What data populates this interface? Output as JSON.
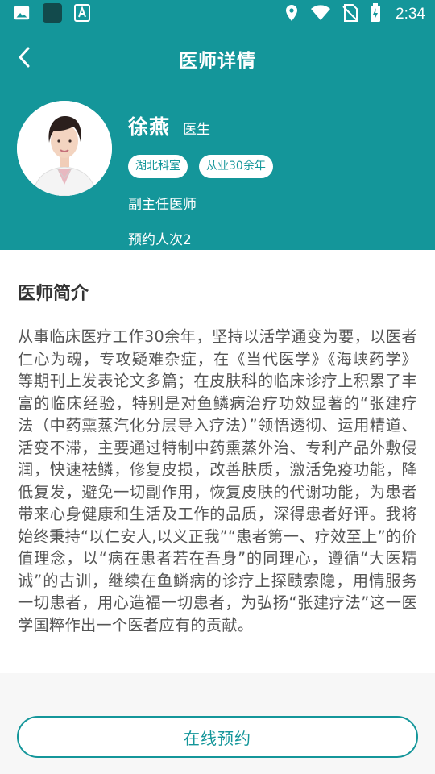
{
  "status_bar": {
    "time": "2:34",
    "left_icons": [
      "image-icon",
      "app-square-icon",
      "font-icon"
    ],
    "right_icons": [
      "location-icon",
      "wifi-icon",
      "no-sim-icon",
      "battery-icon"
    ]
  },
  "header": {
    "title": "医师详情",
    "back_icon": "chevron-left-icon"
  },
  "doctor": {
    "name": "徐燕",
    "role": "医生",
    "tags": [
      "湖北科室",
      "从业30余年"
    ],
    "title": "副主任医师",
    "appointments": "预约人次2"
  },
  "intro": {
    "heading": "医师简介",
    "text": "从事临床医疗工作30余年，坚持以活学通变为要，以医者仁心为魂，专攻疑难杂症，在《当代医学》《海峡药学》等期刊上发表论文多篇；在皮肤科的临床诊疗上积累了丰富的临床经验，特别是对鱼鳞病治疗功效显著的“张建疗法（中药熏蒸汽化分层导入疗法）”领悟透彻、运用精道、活变不滞，主要通过特制中药熏蒸外治、专利产品外敷侵润，快速祛鳞，修复皮损，改善肤质，激活免疫功能，降低复发，避免一切副作用，恢复皮肤的代谢功能，为患者带来心身健康和生活及工作的品质，深得患者好评。我将始终秉持“以仁安人,以义正我”“患者第一、疗效至上”的价值理念，以“病在患者若在吾身”的同理心，遵循“大医精诚”的古训，继续在鱼鳞病的诊疗上探赜索隐，用情服务一切患者，用心造福一切患者，为弘扬“张建疗法”这一医学国粹作出一个医者应有的贡献。"
  },
  "actions": {
    "book_label": "在线预约"
  },
  "colors": {
    "accent": "#14969a",
    "background": "#f7f7f7",
    "text": "#555555"
  }
}
